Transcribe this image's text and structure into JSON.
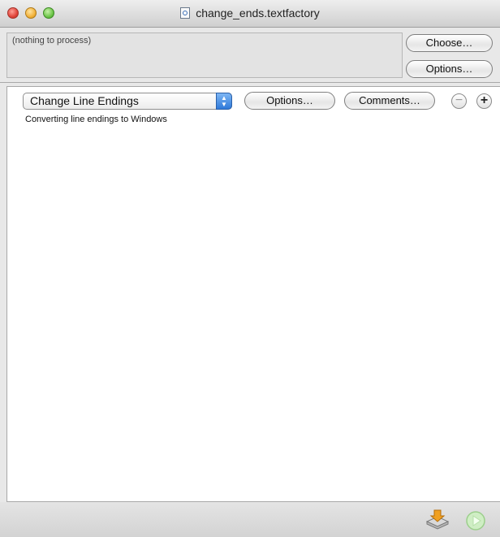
{
  "window": {
    "title": "change_ends.textfactory"
  },
  "source": {
    "status_text": "(nothing to process)",
    "choose_label": "Choose…",
    "options_label": "Options…"
  },
  "action": {
    "selected_action": "Change Line Endings",
    "options_label": "Options…",
    "comments_label": "Comments…",
    "description": "Converting line endings to Windows"
  },
  "icons": {
    "document": "document-icon",
    "remove": "minus-circle-icon",
    "add": "plus-circle-icon",
    "save": "save-tray-icon",
    "run": "play-icon"
  },
  "colors": {
    "close": "#e0443a",
    "minimize": "#f2b33c",
    "maximize": "#6ec64a",
    "popup_accent": "#2f79d9"
  }
}
